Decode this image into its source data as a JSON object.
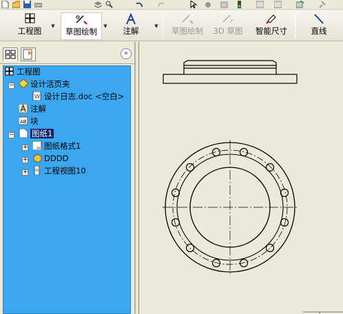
{
  "toolbar": {
    "engineering_drawing_label": "工程图",
    "sketch_label": "草图绘制",
    "annotation_label": "注解",
    "sketch_disabled_label": "草图绘制",
    "sketch_3d_label": "3D 草图",
    "smart_dimension_label": "智能尺寸",
    "line_label": "直线"
  },
  "tree": {
    "root_label": "工程图",
    "design_binder_label": "设计活页夹",
    "design_log_label": "设计日志.doc <空白>",
    "annotations_label": "注解",
    "blocks_label": "块",
    "sheet_label": "图纸1",
    "sheet_format_label": "图纸格式1",
    "dddd_label": "DDDD",
    "drawing_view_label": "工程视图10"
  },
  "colors": {
    "tree_bg": "#3aa7f0",
    "selection": "#0a246a",
    "chrome": "#ece9d8"
  }
}
